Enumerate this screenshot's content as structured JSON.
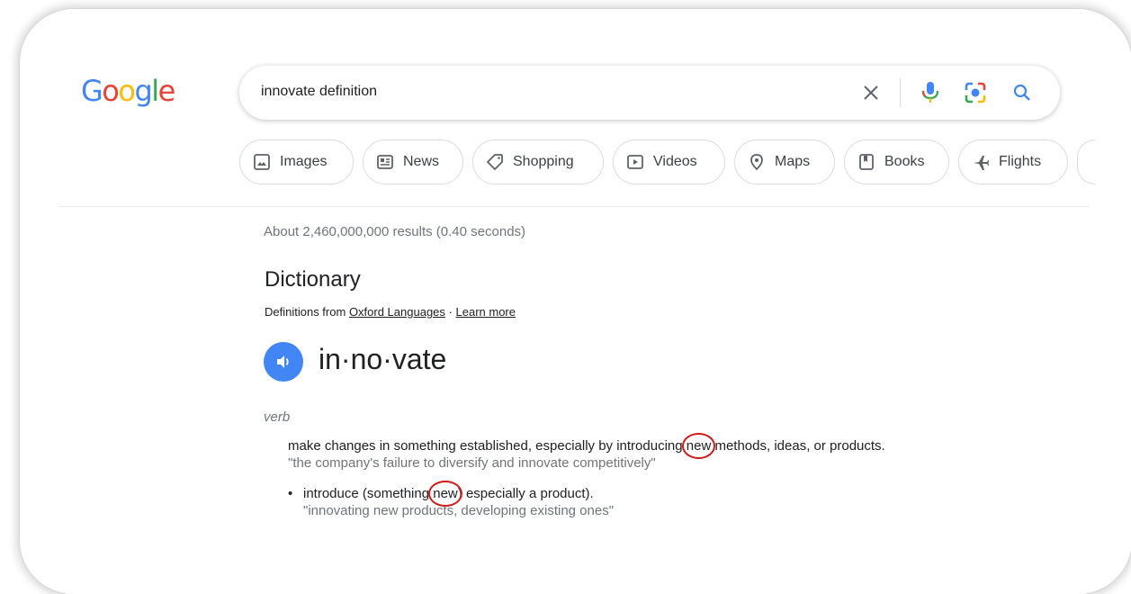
{
  "logo": {
    "letters": [
      "G",
      "o",
      "o",
      "g",
      "l",
      "e"
    ],
    "colors": [
      "#4285f4",
      "#ea4335",
      "#fbbc05",
      "#4285f4",
      "#34a853",
      "#ea4335"
    ]
  },
  "search": {
    "value": "innovate definition",
    "icons": [
      "close-icon",
      "mic-icon",
      "lens-icon",
      "search-icon"
    ]
  },
  "chips": [
    {
      "label": "Images",
      "icon": "image-icon"
    },
    {
      "label": "News",
      "icon": "news-icon"
    },
    {
      "label": "Shopping",
      "icon": "tag-icon"
    },
    {
      "label": "Videos",
      "icon": "play-icon"
    },
    {
      "label": "Maps",
      "icon": "pin-icon"
    },
    {
      "label": "Books",
      "icon": "bookmark-icon"
    },
    {
      "label": "Flights",
      "icon": "plane-icon"
    }
  ],
  "results_stats": "About 2,460,000,000 results (0.40 seconds)",
  "dictionary": {
    "title": "Dictionary",
    "source_prefix": "Definitions from",
    "source_link": "Oxford Languages",
    "separator": "·",
    "learn_more": "Learn more",
    "headword": "in·no·vate",
    "part_of_speech": "verb",
    "definitions": [
      {
        "before": "make changes in something established, especially by introducing ",
        "highlight": "new",
        "after": " methods, ideas, or products.",
        "example": "\"the company's failure to diversify and innovate competitively\""
      },
      {
        "bullet": "•",
        "before": "introduce (something ",
        "highlight": "new",
        "after": ") especially a product).",
        "example": "\"innovating new products, developing existing ones\""
      }
    ]
  },
  "colors": {
    "accent": "#4285f4",
    "annotation": "#d21a1a"
  }
}
